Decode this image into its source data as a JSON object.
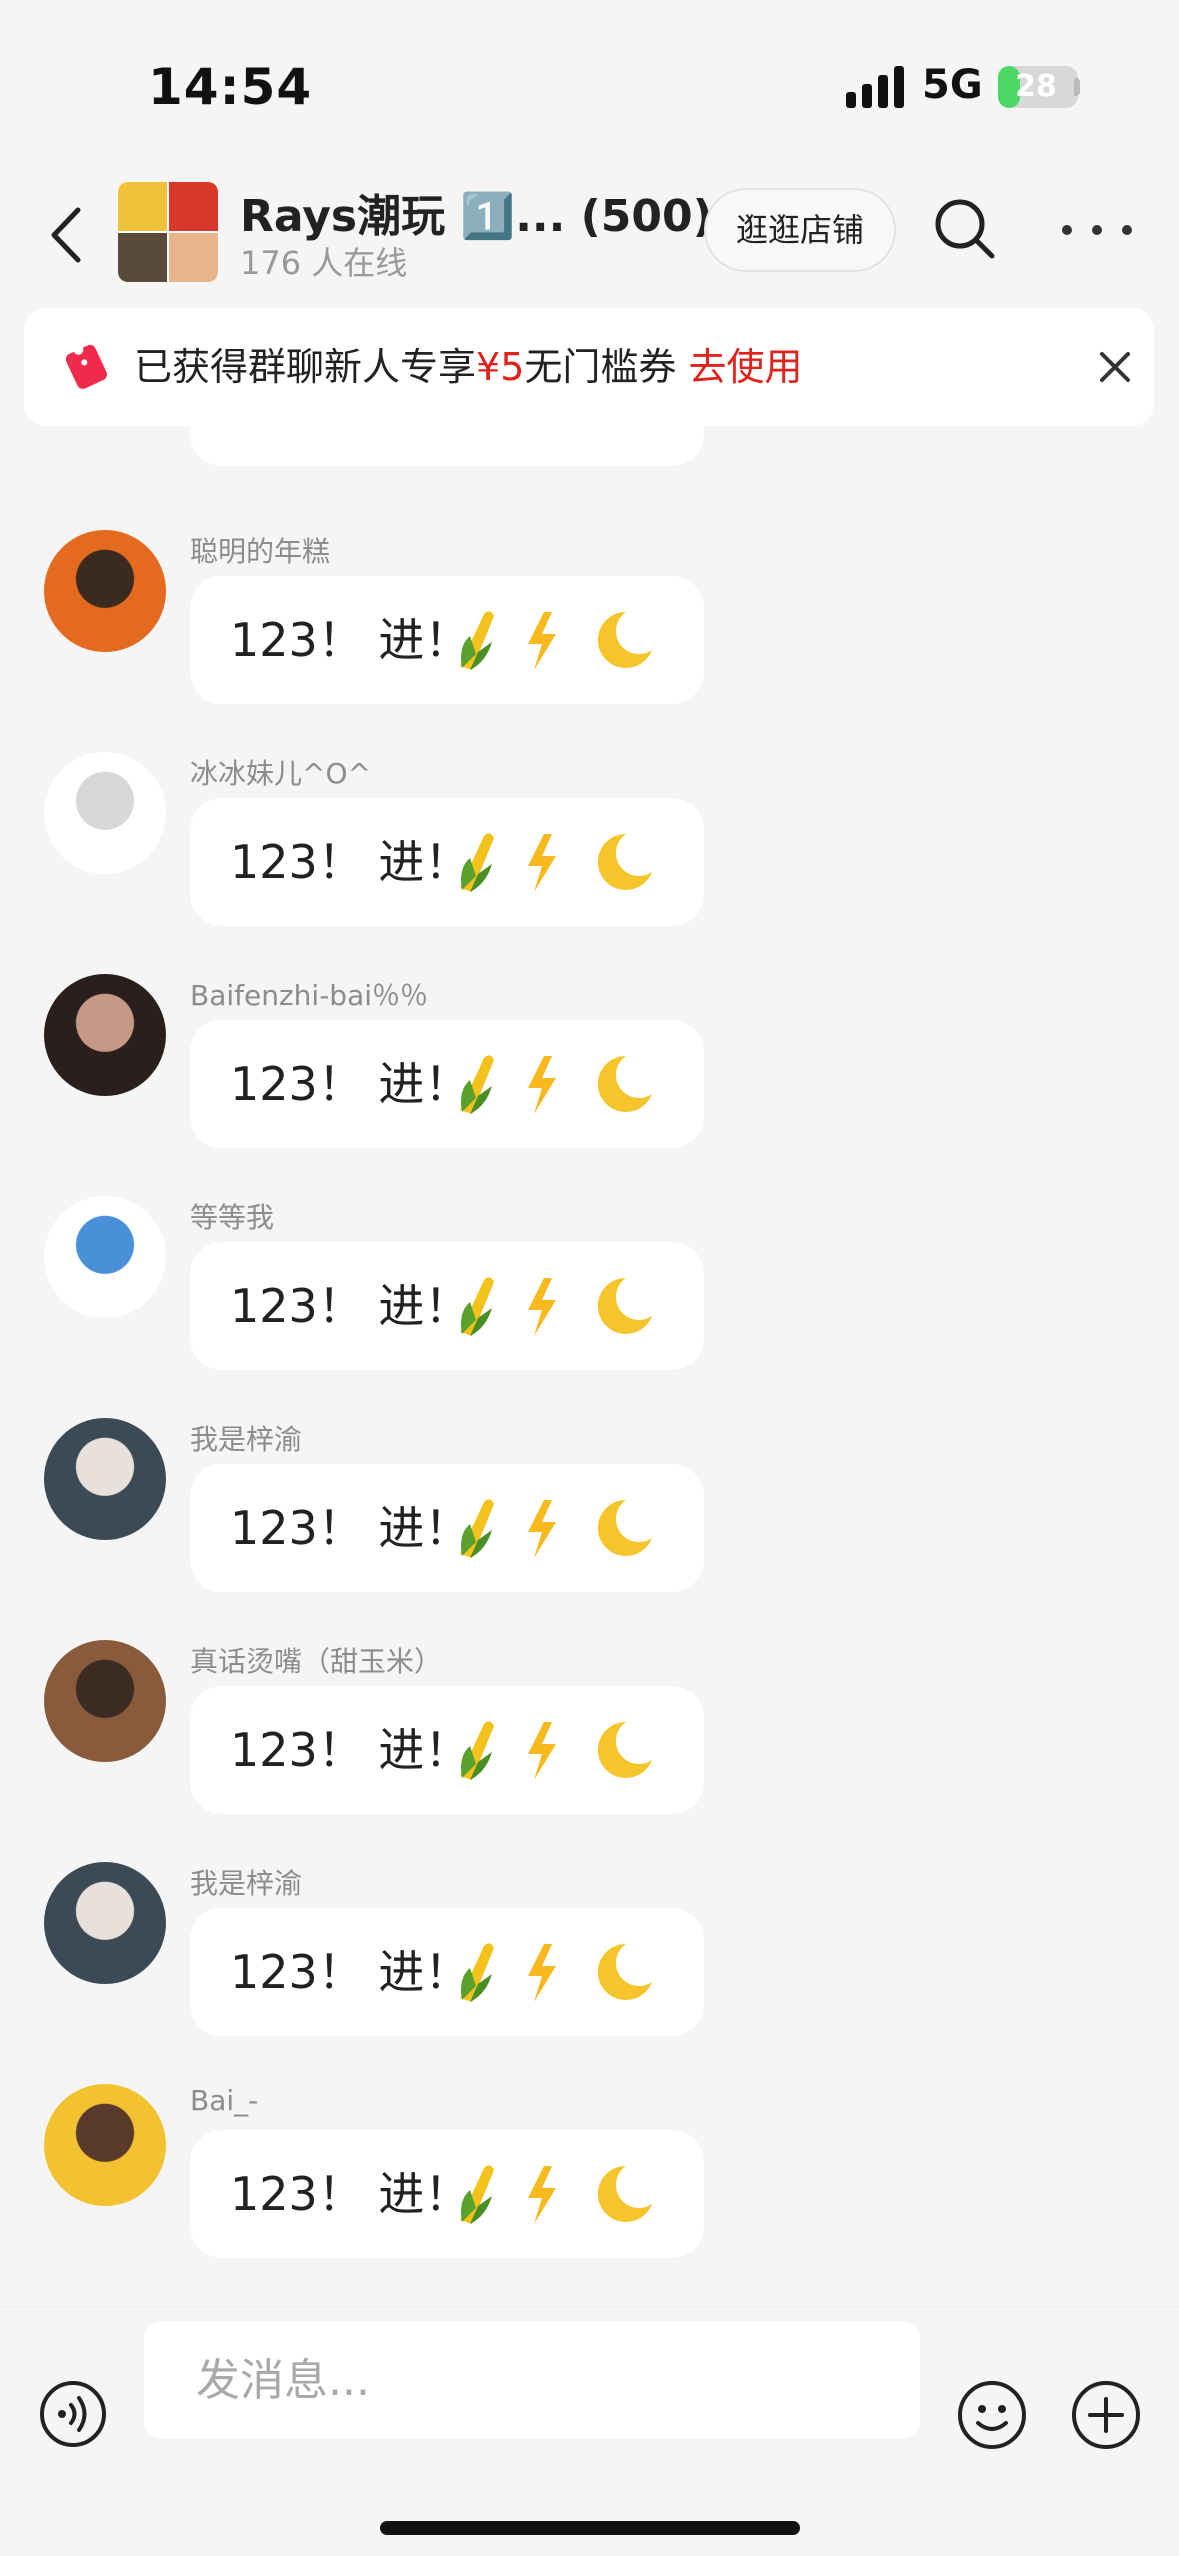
{
  "status_bar": {
    "time": "14:54",
    "network": "5G",
    "battery": "28",
    "battery_level": 0.28
  },
  "header": {
    "title": "Rays潮玩 1️⃣... (500)",
    "online": "176 人在线",
    "shop_label": "逛逛店铺"
  },
  "banner": {
    "prefix": "已获得群聊新人专享",
    "amount": "¥5",
    "suffix": "无门槛券",
    "action": "去使用"
  },
  "messages": [
    {
      "sender": "聪明的年糕",
      "text": "123！ 进！",
      "avatar_colors": [
        "#e46a1f",
        "#3a2a20"
      ]
    },
    {
      "sender": "冰冰妹儿^O^",
      "text": "123！ 进！",
      "avatar_colors": [
        "#ffffff",
        "#d8d8d8"
      ]
    },
    {
      "sender": "Baifenzhi-bai％％",
      "text": "123！ 进！",
      "avatar_colors": [
        "#2a1f1c",
        "#c49a86"
      ]
    },
    {
      "sender": "等等我",
      "text": "123！ 进！",
      "avatar_colors": [
        "#ffffff",
        "#4a90d9"
      ]
    },
    {
      "sender": "我是梓渝",
      "text": "123！ 进！",
      "avatar_colors": [
        "#3c4a55",
        "#e8e0da"
      ]
    },
    {
      "sender": "真话烫嘴（甜玉米）",
      "text": "123！ 进！",
      "avatar_colors": [
        "#8a5a3c",
        "#3b2b22"
      ]
    },
    {
      "sender": "我是梓渝",
      "text": "123！ 进！",
      "avatar_colors": [
        "#3c4a55",
        "#e8e0da"
      ]
    },
    {
      "sender": "Bai_-",
      "text": "123！ 进！",
      "avatar_colors": [
        "#f2c230",
        "#5a3a2a"
      ]
    }
  ],
  "input": {
    "placeholder": "发消息..."
  }
}
